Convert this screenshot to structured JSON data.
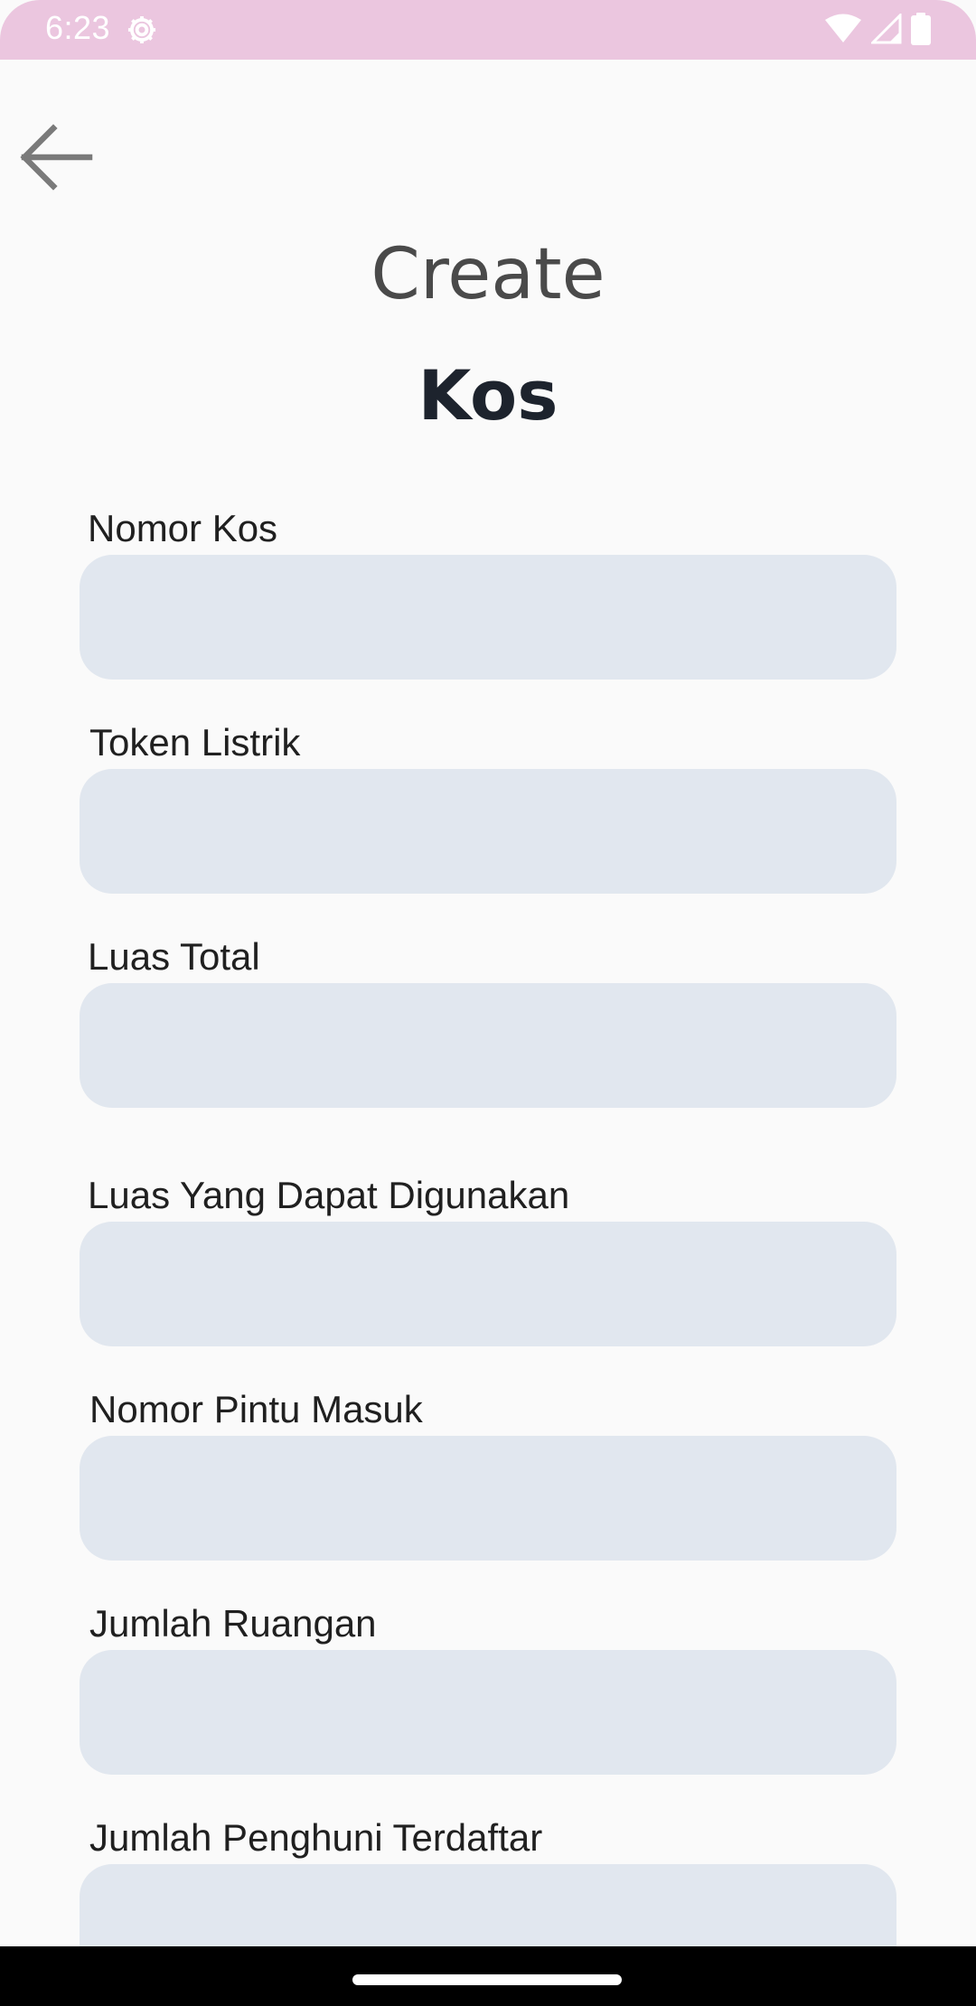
{
  "status_bar": {
    "time": "6:23",
    "icons": [
      "settings-icon",
      "wifi-icon",
      "signal-icon",
      "battery-icon"
    ]
  },
  "header": {
    "back_icon": "arrow-left-icon",
    "title": "Create",
    "subtitle": "Kos"
  },
  "form": {
    "fields": [
      {
        "label": "Nomor Kos",
        "value": ""
      },
      {
        "label": "Token Listrik",
        "value": ""
      },
      {
        "label": "Luas Total",
        "value": ""
      },
      {
        "label": "Luas Yang Dapat Digunakan",
        "value": ""
      },
      {
        "label": "Nomor Pintu Masuk",
        "value": ""
      },
      {
        "label": "Jumlah Ruangan",
        "value": ""
      },
      {
        "label": "Jumlah Penghuni Terdaftar",
        "value": ""
      }
    ]
  },
  "colors": {
    "status_bar": "#ebc6df",
    "background": "#fafafa",
    "input_fill": "#e1e7ef",
    "title_primary": "#1d232d",
    "title_secondary": "#4a4a4a"
  }
}
